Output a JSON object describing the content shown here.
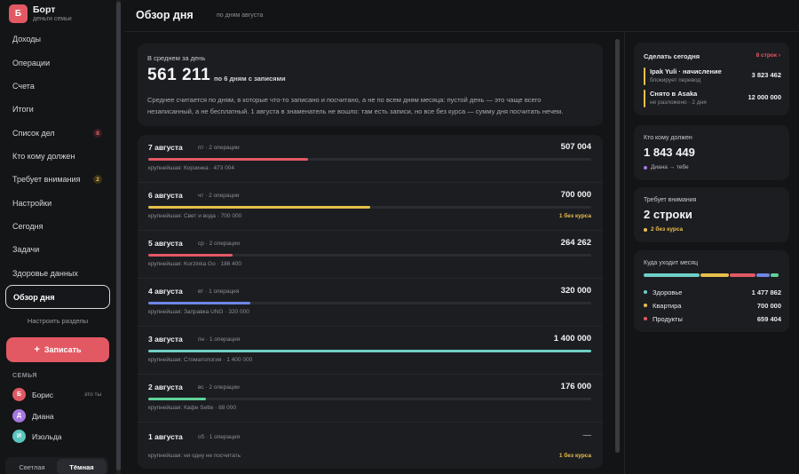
{
  "app": {
    "logo_letter": "Б",
    "name": "Борт",
    "subtitle": "деньги семьи"
  },
  "nav": [
    {
      "label": "Доходы"
    },
    {
      "label": "Операции"
    },
    {
      "label": "Счета"
    },
    {
      "label": "Итоги"
    },
    {
      "label": "Список дел",
      "badge": "8"
    },
    {
      "label": "Кто кому должен"
    },
    {
      "label": "Требует внимания",
      "badge": "2"
    },
    {
      "label": "Настройки"
    },
    {
      "label": "Сегодня"
    },
    {
      "label": "Задачи"
    },
    {
      "label": "Здоровье данных"
    },
    {
      "label": "Обзор дня"
    }
  ],
  "nav_config": "Настроить разделы",
  "add_button": {
    "icon": "+",
    "label": "Записать"
  },
  "family": {
    "title": "СЕМЬЯ",
    "members": [
      {
        "initial": "Б",
        "name": "Борис",
        "note": "это ты",
        "color": "#e25964"
      },
      {
        "initial": "Д",
        "name": "Диана",
        "note": "",
        "color": "#a678e0"
      },
      {
        "initial": "И",
        "name": "Изольда",
        "note": "",
        "color": "#5bc6bd"
      }
    ]
  },
  "theme": {
    "light": "Светлая",
    "dark": "Тёмная"
  },
  "header": {
    "title": "Обзор дня",
    "subtitle": "по дням августа"
  },
  "average": {
    "label": "В среднем за день",
    "value": "561 211",
    "value_note": "по 6 дням с записями",
    "description": "Среднее считается по дням, в которые что-то записано и посчитано, а не по всем дням месяца: пустой день — это чаще всего незаписанный, а не бесплатный. 1 августа в знаменатель не вошло: там есть записи, но все без курса — сумму дня посчитать нечем."
  },
  "days": [
    {
      "date": "7 августа",
      "meta": "пт · 2 операции",
      "total": "507 004",
      "biggest": "крупнейшая: Корзинка · 473 004",
      "share": 0.36,
      "color": "#e25964",
      "warning": ""
    },
    {
      "date": "6 августа",
      "meta": "чт · 2 операции",
      "total": "700 000",
      "biggest": "крупнейшая: Свет и вода · 700 000",
      "share": 0.5,
      "color": "#e8bf4b",
      "warning": "1 без курса"
    },
    {
      "date": "5 августа",
      "meta": "ср · 2 операции",
      "total": "264 262",
      "biggest": "крупнейшая: Korzinka Go · 186 400",
      "share": 0.19,
      "color": "#e25964",
      "warning": ""
    },
    {
      "date": "4 августа",
      "meta": "вт · 1 операция",
      "total": "320 000",
      "biggest": "крупнейшая: Заправка UNG · 320 000",
      "share": 0.23,
      "color": "#6f86e6",
      "warning": ""
    },
    {
      "date": "3 августа",
      "meta": "пн · 1 операция",
      "total": "1 400 000",
      "biggest": "крупнейшая: Стоматология · 1 400 000",
      "share": 1.0,
      "color": "#6fcfc6",
      "warning": ""
    },
    {
      "date": "2 августа",
      "meta": "вс · 2 операции",
      "total": "176 000",
      "biggest": "крупнейшая: Кафе Sette · 88 000",
      "share": 0.13,
      "color": "#5fd39a",
      "warning": ""
    },
    {
      "date": "1 августа",
      "meta": "сб · 1 операция",
      "total": "—",
      "biggest": "крупнейшая: ни одну не посчитать",
      "share": 0,
      "color": "#6fcfc6",
      "warning": "1 без курса"
    }
  ],
  "today": {
    "title": "Сделать сегодня",
    "link": "8 строк ›",
    "items": [
      {
        "title": "Ipak Yuli · начисление",
        "sub": "блокирует перевод",
        "value": "3 823 462"
      },
      {
        "title": "Снято в Asaka",
        "sub": "не разложено · 2 дня",
        "value": "12 000 000"
      }
    ]
  },
  "owe": {
    "title": "Кто кому должен",
    "value": "1 843 449",
    "note": "Диана → тебе",
    "dot_color": "#a678e0"
  },
  "attention": {
    "title": "Требует внимания",
    "value": "2 строки",
    "note": "2 без курса",
    "dot_color": "#e8bf4b"
  },
  "month": {
    "title": "Куда уходит месяц",
    "stack": [
      {
        "color": "#6fcfc6",
        "share": 0.42
      },
      {
        "color": "#e8bf4b",
        "share": 0.21
      },
      {
        "color": "#e25964",
        "share": 0.19
      },
      {
        "color": "#6f86e6",
        "share": 0.1
      },
      {
        "color": "#5fd39a",
        "share": 0.06
      }
    ],
    "legend": [
      {
        "label": "Здоровье",
        "value": "1 477 862",
        "color": "#6fcfc6"
      },
      {
        "label": "Квартира",
        "value": "700 000",
        "color": "#e8bf4b"
      },
      {
        "label": "Продукты",
        "value": "659 404",
        "color": "#e25964"
      }
    ]
  }
}
